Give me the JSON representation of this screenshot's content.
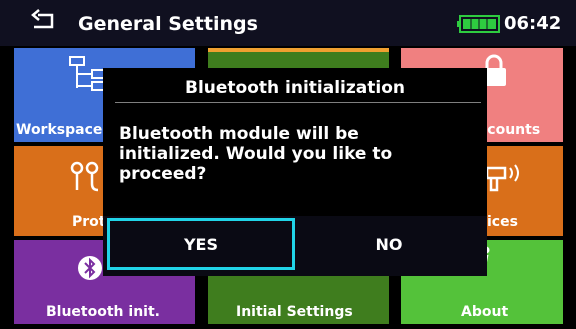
{
  "header": {
    "title": "General Settings",
    "time": "06:42",
    "back_icon": "back-arrow-icon",
    "battery_icon": "battery-icon"
  },
  "tiles": [
    {
      "label": "Workspace",
      "icon": "workspace-tree-icon",
      "color": "#3f6fd6"
    },
    {
      "label": "Accounts",
      "icon": "lock-icon",
      "color": "#f08080"
    },
    {
      "label": "Profiles",
      "icon": "profile-icon",
      "color": "#d96f1a"
    },
    {
      "label": "Devices",
      "icon": "device-wireless-icon",
      "color": "#d96f1a"
    },
    {
      "label": "Bluetooth init.",
      "icon": "bluetooth-icon",
      "color": "#7a2fa0"
    },
    {
      "label": "Initial Settings",
      "icon": "initial-settings-icon",
      "color": "#3f7d1e"
    },
    {
      "label": "About",
      "icon": "info-icon",
      "color": "#54c23a"
    }
  ],
  "dialog": {
    "title": "Bluetooth initialization",
    "message": "Bluetooth module will be\ninitialized. Would you like to\nproceed?",
    "yes_label": "YES",
    "no_label": "NO",
    "focus_color": "#21d4e8"
  }
}
